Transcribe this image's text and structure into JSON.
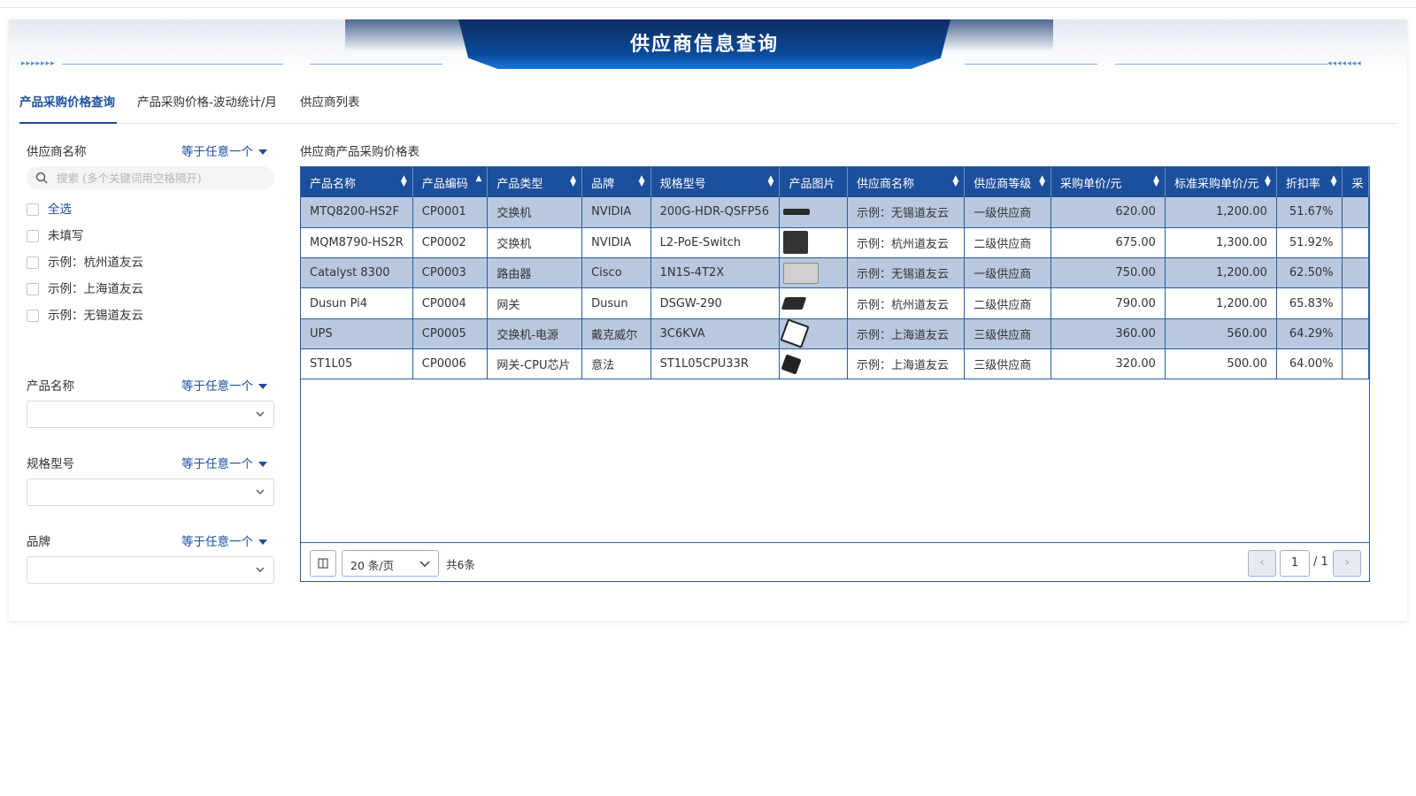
{
  "page": {
    "title": "供应商信息查询"
  },
  "tabs": [
    {
      "label": "产品采购价格查询"
    },
    {
      "label": "产品采购价格-波动统计/月"
    },
    {
      "label": "供应商列表"
    }
  ],
  "filters": {
    "supplier": {
      "label": "供应商名称",
      "operator": "等于任意一个",
      "search_placeholder": "搜索 (多个关键词用空格隔开)",
      "options": [
        {
          "label": "全选"
        },
        {
          "label": "未填写"
        },
        {
          "label": "示例：杭州道友云"
        },
        {
          "label": "示例：上海道友云"
        },
        {
          "label": "示例：无锡道友云"
        }
      ]
    },
    "product_name": {
      "label": "产品名称",
      "operator": "等于任意一个"
    },
    "spec_model": {
      "label": "规格型号",
      "operator": "等于任意一个"
    },
    "brand": {
      "label": "品牌",
      "operator": "等于任意一个"
    }
  },
  "table": {
    "title": "供应商产品采购价格表",
    "columns": [
      {
        "label": "产品名称"
      },
      {
        "label": "产品编码"
      },
      {
        "label": "产品类型"
      },
      {
        "label": "品牌"
      },
      {
        "label": "规格型号"
      },
      {
        "label": "产品图片"
      },
      {
        "label": "供应商名称"
      },
      {
        "label": "供应商等级"
      },
      {
        "label": "采购单价/元"
      },
      {
        "label": "标准采购单价/元"
      },
      {
        "label": "折扣率"
      },
      {
        "label": "采"
      }
    ],
    "rows": [
      {
        "name": "MTQ8200-HS2F",
        "code": "CP0001",
        "type": "交换机",
        "brand": "NVIDIA",
        "model": "200G-HDR-QSFP56",
        "image": "switch-image",
        "supplier": "示例：无锡道友云",
        "level": "一级供应商",
        "price": "620.00",
        "std_price": "1,200.00",
        "discount": "51.67%"
      },
      {
        "name": "MQM8790-HS2R",
        "code": "CP0002",
        "type": "交换机",
        "brand": "NVIDIA",
        "model": "L2-PoE-Switch",
        "image": "switch-image",
        "supplier": "示例：杭州道友云",
        "level": "二级供应商",
        "price": "675.00",
        "std_price": "1,300.00",
        "discount": "51.92%"
      },
      {
        "name": "Catalyst 8300",
        "code": "CP0003",
        "type": "路由器",
        "brand": "Cisco",
        "model": "1N1S-4T2X",
        "image": "router-image",
        "supplier": "示例：无锡道友云",
        "level": "一级供应商",
        "price": "750.00",
        "std_price": "1,200.00",
        "discount": "62.50%"
      },
      {
        "name": "Dusun Pi4",
        "code": "CP0004",
        "type": "网关",
        "brand": "Dusun",
        "model": "DSGW-290",
        "image": "gateway-image",
        "supplier": "示例：杭州道友云",
        "level": "二级供应商",
        "price": "790.00",
        "std_price": "1,200.00",
        "discount": "65.83%"
      },
      {
        "name": "UPS",
        "code": "CP0005",
        "type": "交换机-电源",
        "brand": "戴克威尔",
        "model": "3C6KVA",
        "image": "ups-image",
        "supplier": "示例：上海道友云",
        "level": "三级供应商",
        "price": "360.00",
        "std_price": "560.00",
        "discount": "64.29%"
      },
      {
        "name": "ST1L05",
        "code": "CP0006",
        "type": "网关-CPU芯片",
        "brand": "意法",
        "model": "ST1L05CPU33R",
        "image": "chip-image",
        "supplier": "示例：上海道友云",
        "level": "三级供应商",
        "price": "320.00",
        "std_price": "500.00",
        "discount": "64.00%"
      }
    ]
  },
  "pagination": {
    "page_size": "20 条/页",
    "total": "共6条",
    "current_page": "1",
    "total_pages": "/ 1"
  },
  "colors": {
    "accent": "#1c4f9c",
    "row_highlight": "#b9c8df"
  }
}
